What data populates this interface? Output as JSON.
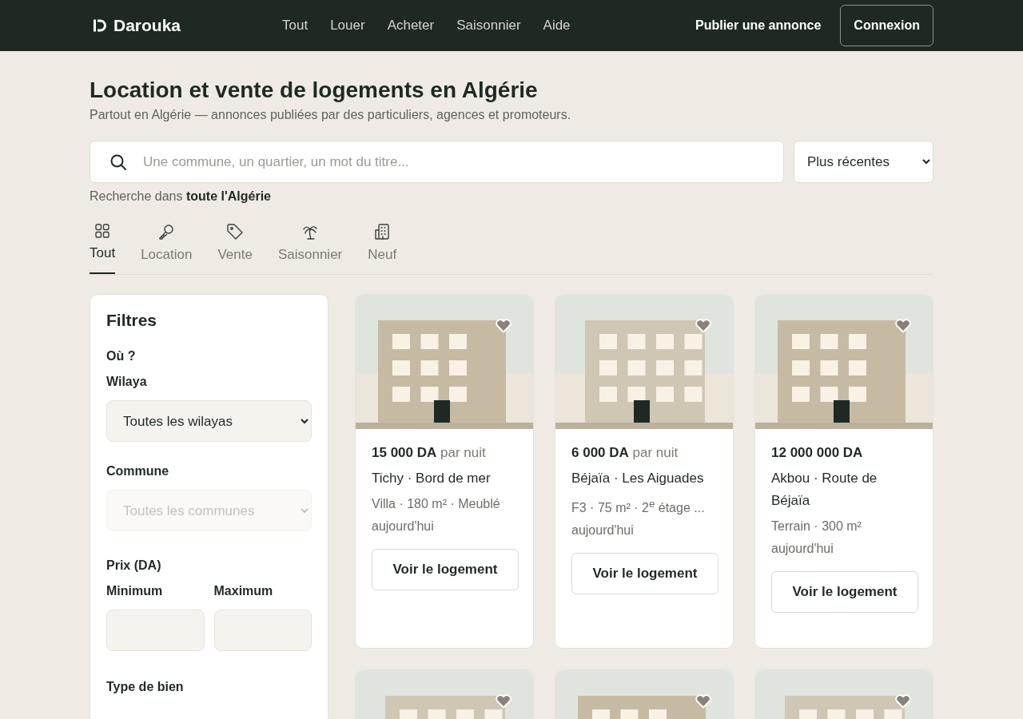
{
  "header": {
    "logo": "Darouka",
    "nav": [
      {
        "label": "Tout"
      },
      {
        "label": "Louer"
      },
      {
        "label": "Acheter"
      },
      {
        "label": "Saisonnier"
      },
      {
        "label": "Aide"
      }
    ],
    "publish": "Publier une annonce",
    "login": "Connexion"
  },
  "page": {
    "title": "Location et vente de logements en Algérie",
    "subtitle": "Partout en Algérie — annonces publiées par des particuliers, agences et promoteurs."
  },
  "search": {
    "placeholder": "Une commune, un quartier, un mot du titre...",
    "sort": "Plus récentes",
    "scope": "Recherche dans **toute l'Algérie**"
  },
  "tabs": [
    {
      "label": "Tout",
      "selected": true
    },
    {
      "label": "Location",
      "selected": false
    },
    {
      "label": "Vente",
      "selected": false
    },
    {
      "label": "Saisonnier",
      "selected": false
    },
    {
      "label": "Neuf",
      "selected": false
    }
  ],
  "filters": {
    "title": "Filtres",
    "sections": [
      {
        "kind": "heading",
        "label": "Où ?"
      },
      {
        "kind": "select",
        "label": "Wilaya",
        "value": "Toutes les wilayas",
        "disabled": false
      },
      {
        "kind": "select",
        "label": "Commune",
        "value": "Toutes les communes",
        "disabled": true
      },
      {
        "kind": "heading",
        "label": "Prix (DA)"
      },
      {
        "kind": "range",
        "fields": [
          {
            "label": "Minimum"
          },
          {
            "label": "Maximum"
          }
        ]
      },
      {
        "kind": "heading",
        "label": "Type de bien"
      }
    ]
  },
  "listings": [
    {
      "kind": "full",
      "price": "15 000 DA",
      "unit": "par nuit",
      "place": "Tichy · Bord de mer",
      "details": "Villa · 180 m² · Meublé",
      "date": "aujourd'hui",
      "button": "Voir le logement"
    },
    {
      "kind": "full",
      "price": "6 000 DA",
      "unit": "par nuit",
      "place": "Béjaïa · Les Aiguades",
      "details": "F3 · 75 m² · 2$^{e}$ étage ...",
      "date": "aujourd'hui",
      "button": "Voir le logement"
    },
    {
      "kind": "full",
      "price": "12 000 000 DA",
      "place": "Akbou · Route de Béjaïa",
      "details": "Terrain · 300 m²",
      "date": "aujourd'hui",
      "button": "Voir le logement"
    },
    {
      "kind": "picture"
    },
    {
      "kind": "picture"
    },
    {
      "kind": "picture"
    }
  ]
}
